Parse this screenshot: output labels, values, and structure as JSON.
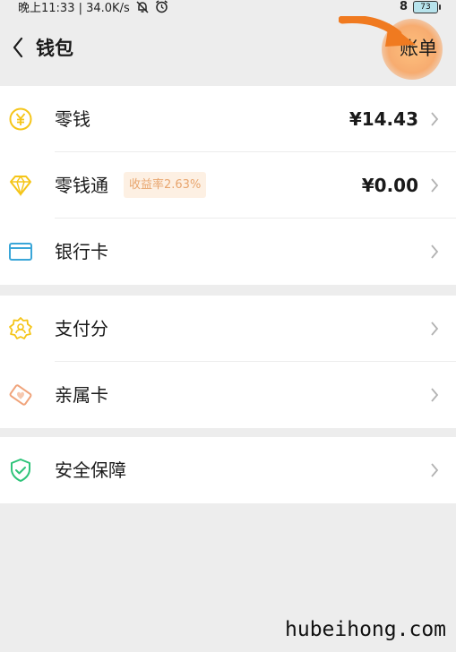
{
  "status_bar": {
    "time_text": "晚上11:33 | 34.0K/s",
    "bluetooth_glyph": "8",
    "battery_level": "73",
    "icons": [
      "mute-bell-icon",
      "alarm-clock-icon",
      "bluetooth-icon",
      "battery-icon"
    ]
  },
  "nav": {
    "title": "钱包",
    "bill_label": "账单",
    "highlight_color": "#f59a4a",
    "arrow_color": "#f07a20"
  },
  "groups": [
    {
      "rows": [
        {
          "label": "零钱",
          "value": "¥14.43",
          "icon": "coin-yen-icon",
          "icon_color": "#f5c518"
        },
        {
          "label": "零钱通",
          "badge": "收益率2.63%",
          "value": "¥0.00",
          "icon": "diamond-icon",
          "icon_color": "#f5c518"
        },
        {
          "label": "银行卡",
          "icon": "bank-card-icon",
          "icon_color": "#3aa6d8"
        }
      ]
    },
    {
      "rows": [
        {
          "label": "支付分",
          "icon": "pay-score-icon",
          "icon_color": "#f5c518"
        },
        {
          "label": "亲属卡",
          "icon": "family-card-icon",
          "icon_color": "#f0a37a"
        }
      ]
    },
    {
      "rows": [
        {
          "label": "安全保障",
          "icon": "shield-check-icon",
          "icon_color": "#2fc47a"
        }
      ]
    }
  ],
  "watermark": "hubeihong.com",
  "colors": {
    "page_background": "#ededed",
    "badge_background": "#fdf0e3",
    "badge_text": "#e8a56e"
  }
}
